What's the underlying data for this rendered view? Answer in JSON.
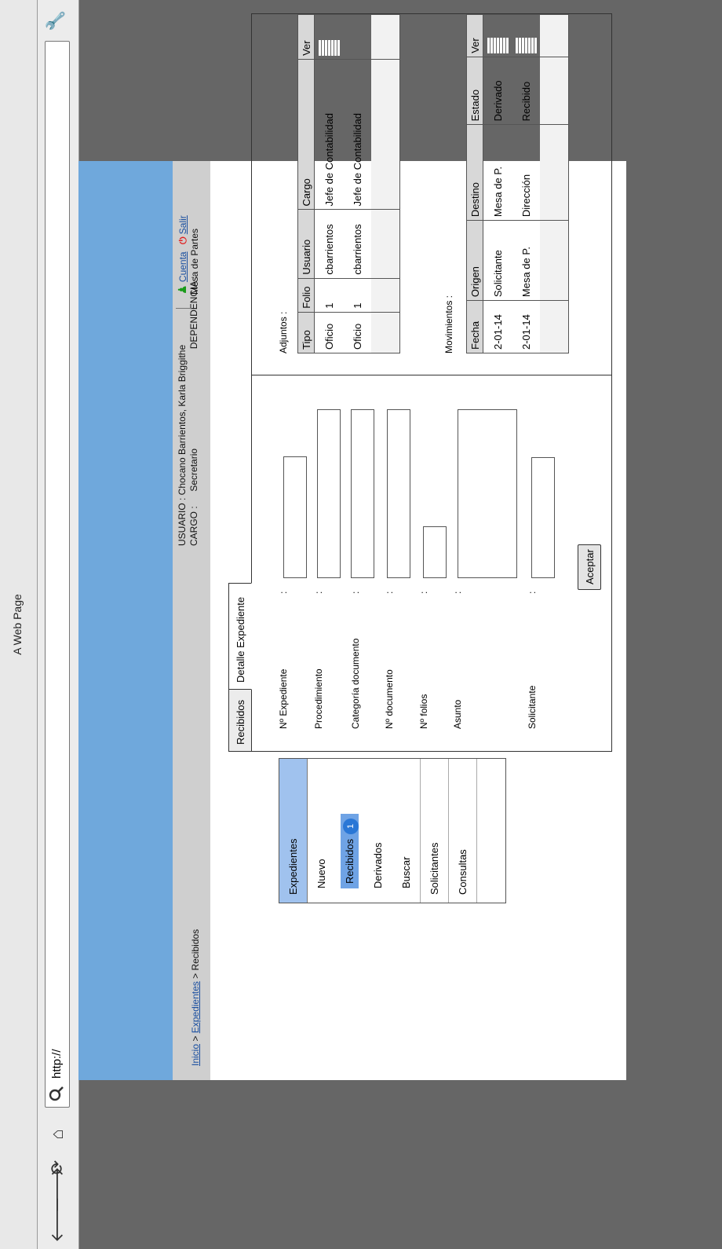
{
  "window": {
    "title": "A Web Page"
  },
  "toolbar": {
    "url": "http://"
  },
  "header": {
    "breadcrumb": {
      "home": "Inicio",
      "sep1": ">",
      "section": "Expedientes",
      "sep2": ">",
      "current": "Recibidos"
    },
    "usuario_label": "USUARIO :",
    "usuario_value": "Chocano Barrientos, Karla Briggithe",
    "cargo_label": "CARGO   :",
    "cargo_value": "Secretario",
    "dependencia_label": "DEPENDENCIA :",
    "dependencia_value": "Mesa de Partes",
    "cuenta": "Cuenta",
    "salir": "Salir"
  },
  "sidebar": {
    "items": [
      {
        "label": "Expedientes"
      },
      {
        "label": "Nuevo"
      },
      {
        "label": "Recibidos",
        "badge": "1"
      },
      {
        "label": "Derivados"
      },
      {
        "label": "Buscar"
      },
      {
        "label": "Solicitantes"
      },
      {
        "label": "Consultas"
      }
    ]
  },
  "tabs": [
    {
      "label": "Recibidos"
    },
    {
      "label": "Detalle Expediente"
    }
  ],
  "form": {
    "n_expediente": "Nº Expediente",
    "procedimiento": "Procedimiento",
    "categoria": "Categoría documento",
    "n_documento": "Nº documento",
    "n_folios": "Nº folios",
    "asunto": "Asunto",
    "solicitante": "Solicitante",
    "colon": ":",
    "accept": "Aceptar"
  },
  "adjuntos": {
    "title": "Adjuntos :",
    "headers": [
      "Tipo",
      "Folio",
      "Usuario",
      "Cargo",
      "Ver"
    ],
    "rows": [
      [
        "Oficio",
        "1",
        "cbarrientos",
        "Jefe de Contabilidad"
      ],
      [
        "Oficio",
        "1",
        "cbarrientos",
        "Jefe de Contabilidad"
      ]
    ]
  },
  "movimientos": {
    "title": "Movimientos :",
    "headers": [
      "Fecha",
      "Origen",
      "Destino",
      "Estado",
      "Ver"
    ],
    "rows": [
      [
        "2-01-14",
        "Solicitante",
        "Mesa de P.",
        "Derivado"
      ],
      [
        "2-01-14",
        "Mesa de P.",
        "Dirección",
        "Recibido"
      ]
    ]
  },
  "colors": {
    "accent": "#6fa8dc",
    "header_bg": "#cfcfcf",
    "active_item": "#6fa3e5",
    "badge": "#2a77d6"
  }
}
